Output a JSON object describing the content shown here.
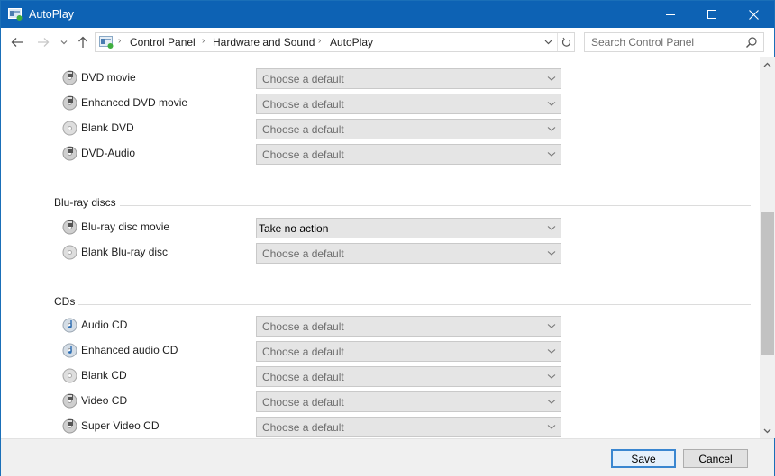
{
  "window": {
    "title": "AutoPlay",
    "controls": {
      "minimize": "minimize",
      "maximize": "maximize",
      "close": "close"
    }
  },
  "nav": {
    "back_icon": "arrow-left-icon",
    "forward_icon": "arrow-right-icon",
    "recent_icon": "chevron-down-icon",
    "up_icon": "arrow-up-icon",
    "breadcrumb": [
      "Control Panel",
      "Hardware and Sound",
      "AutoPlay"
    ],
    "search_placeholder": "Search Control Panel"
  },
  "sections": [
    {
      "title": "",
      "items": [
        {
          "label": "DVD movie",
          "icon": "dvd-video-icon",
          "value": "Choose a default",
          "is_set": false
        },
        {
          "label": "Enhanced DVD movie",
          "icon": "dvd-video-icon",
          "value": "Choose a default",
          "is_set": false
        },
        {
          "label": "Blank DVD",
          "icon": "blank-disc-icon",
          "value": "Choose a default",
          "is_set": false
        },
        {
          "label": "DVD-Audio",
          "icon": "dvd-video-icon",
          "value": "Choose a default",
          "is_set": false
        }
      ]
    },
    {
      "title": "Blu-ray discs",
      "items": [
        {
          "label": "Blu-ray disc movie",
          "icon": "dvd-video-icon",
          "value": "Take no action",
          "is_set": true
        },
        {
          "label": "Blank Blu-ray disc",
          "icon": "blank-disc-icon",
          "value": "Choose a default",
          "is_set": false
        }
      ]
    },
    {
      "title": "CDs",
      "items": [
        {
          "label": "Audio CD",
          "icon": "audio-disc-icon",
          "value": "Choose a default",
          "is_set": false
        },
        {
          "label": "Enhanced audio CD",
          "icon": "audio-disc-icon",
          "value": "Choose a default",
          "is_set": false
        },
        {
          "label": "Blank CD",
          "icon": "blank-disc-icon",
          "value": "Choose a default",
          "is_set": false
        },
        {
          "label": "Video CD",
          "icon": "dvd-video-icon",
          "value": "Choose a default",
          "is_set": false
        },
        {
          "label": "Super Video CD",
          "icon": "dvd-video-icon",
          "value": "Choose a default",
          "is_set": false
        }
      ]
    }
  ],
  "footer": {
    "save_label": "Save",
    "cancel_label": "Cancel"
  },
  "colors": {
    "titlebar": "#0d62b4",
    "accent": "#3a86d0"
  }
}
